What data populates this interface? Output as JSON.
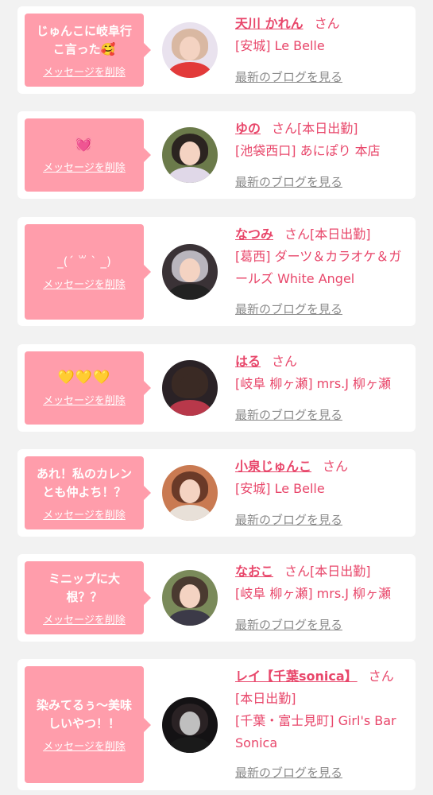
{
  "colors": {
    "accent": "#e8466a",
    "bubble": "#ff9dab",
    "background": "#f2f2f2"
  },
  "delete_label": "メッセージを削除",
  "blog_label": "最新のブログを見る",
  "san": "さん",
  "entries": [
    {
      "message": "じゅんこに岐阜行\nこ言った🥰",
      "name": "天川 かれん",
      "status": "",
      "shop": "[安城] Le Belle"
    },
    {
      "message": "💓",
      "name": "ゆの",
      "status": "[本日出勤]",
      "shop": "[池袋西口] あにぽり 本店"
    },
    {
      "message": "_(´ ꒳ ` _)",
      "name": "なつみ",
      "status": "[本日出勤]",
      "shop": "[葛西] ダーツ＆カラオケ＆ガールズ White Angel"
    },
    {
      "message": "💛💛💛",
      "name": "はる",
      "status": "",
      "shop": "[岐阜 柳ヶ瀬] mrs.J 柳ヶ瀬"
    },
    {
      "message": "あれ！私のカレン\nとも仲よち！？",
      "name": "小泉じゅんこ",
      "status": "",
      "shop": "[安城] Le Belle"
    },
    {
      "message": "ミニップに大\n根？？",
      "name": "なおこ",
      "status": "[本日出勤]",
      "shop": "[岐阜 柳ヶ瀬] mrs.J 柳ヶ瀬"
    },
    {
      "message": "染みてるぅ〜美味\nしいやつ！！",
      "name": "レイ【千葉sonica】",
      "status": "[本日出勤]",
      "shop": "[千葉・富士見町] Girl's Bar Sonica"
    }
  ]
}
